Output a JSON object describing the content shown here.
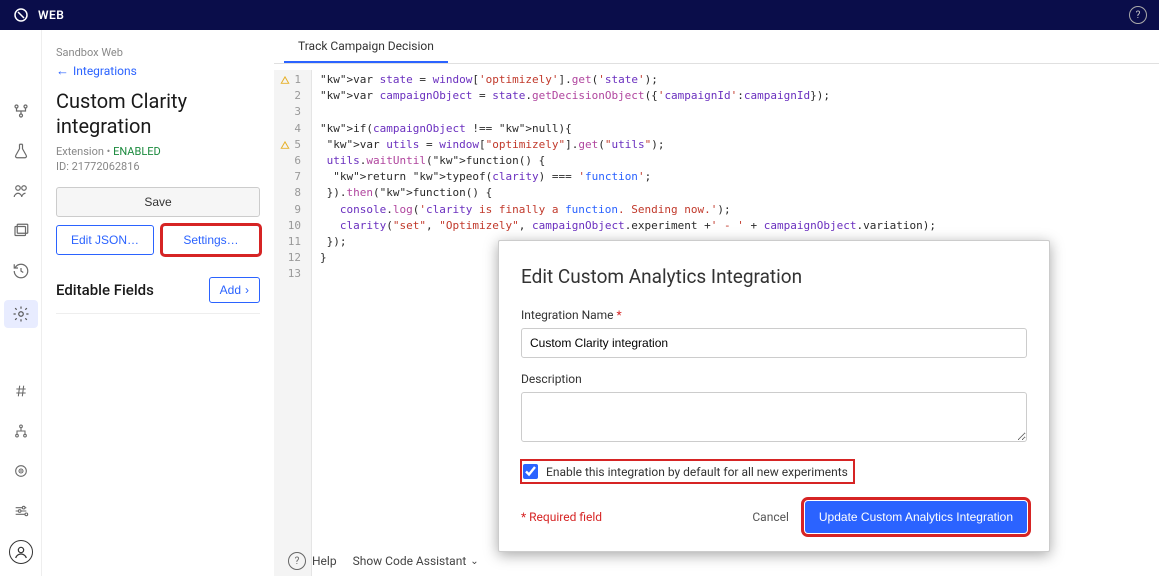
{
  "topbar": {
    "app_name": "WEB"
  },
  "sidebar": {
    "breadcrumb": "Sandbox Web",
    "back_label": "Integrations",
    "title": "Custom Clarity integration",
    "ext_label": "Extension",
    "status": "ENABLED",
    "id_label": "ID: 21772062816",
    "save_label": "Save",
    "edit_json_label": "Edit JSON…",
    "settings_label": "Settings…",
    "editable_fields_label": "Editable Fields",
    "add_label": "Add"
  },
  "editor": {
    "tab_label": "Track Campaign Decision",
    "code_lines": [
      "var state = window['optimizely'].get('state');",
      "var campaignObject = state.getDecisionObject({'campaignId':campaignId});",
      "",
      "if(campaignObject !== null){",
      " var utils = window[\"optimizely\"].get(\"utils\");",
      " utils.waitUntil(function() {",
      "  return typeof(clarity) === 'function';",
      " }).then(function() {",
      "   console.log('clarity is finally a function. Sending now.');",
      "   clarity(\"set\", \"Optimizely\", campaignObject.experiment +' - ' + campaignObject.variation);",
      " });",
      "}",
      ""
    ],
    "warn_lines": [
      1,
      5
    ]
  },
  "footer": {
    "help_label": "Help",
    "assist_label": "Show Code Assistant"
  },
  "modal": {
    "title": "Edit Custom Analytics Integration",
    "name_label": "Integration Name",
    "name_value": "Custom Clarity integration",
    "desc_label": "Description",
    "desc_value": "",
    "checkbox_label": "Enable this integration by default for all new experiments",
    "checkbox_checked": true,
    "required_text": "* Required field",
    "cancel_label": "Cancel",
    "submit_label": "Update Custom Analytics Integration"
  }
}
